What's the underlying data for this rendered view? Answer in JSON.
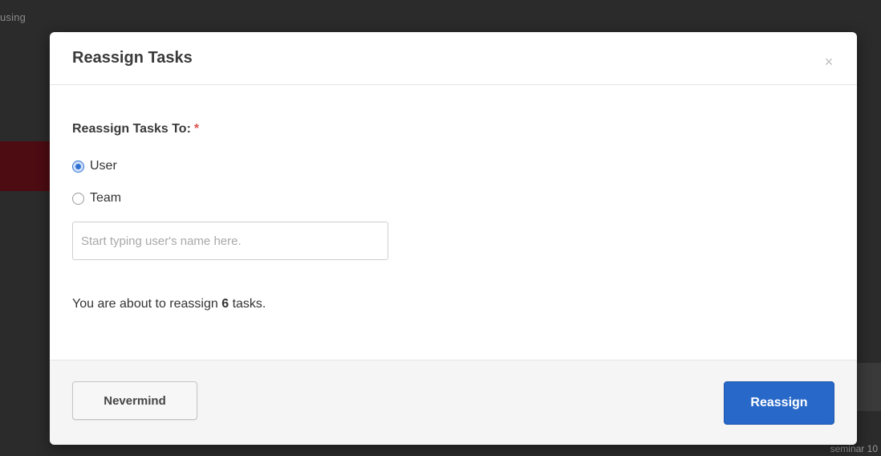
{
  "background": {
    "top_left_text": "using",
    "bottom_right_text": "seminar 10"
  },
  "modal": {
    "title": "Reassign Tasks",
    "close_icon": "close-icon",
    "close_glyph": "×",
    "field_label": "Reassign Tasks To:",
    "required_marker": "*",
    "options": [
      {
        "label": "User",
        "checked": true
      },
      {
        "label": "Team",
        "checked": false
      }
    ],
    "input": {
      "placeholder": "Start typing user's name here.",
      "value": ""
    },
    "summary": {
      "prefix": "You are about to reassign ",
      "count": "6",
      "suffix": " tasks."
    },
    "footer": {
      "cancel_label": "Nevermind",
      "confirm_label": "Reassign"
    }
  },
  "colors": {
    "primary": "#2868c8",
    "required": "#d9534f",
    "background_accent": "#4d0b12"
  }
}
